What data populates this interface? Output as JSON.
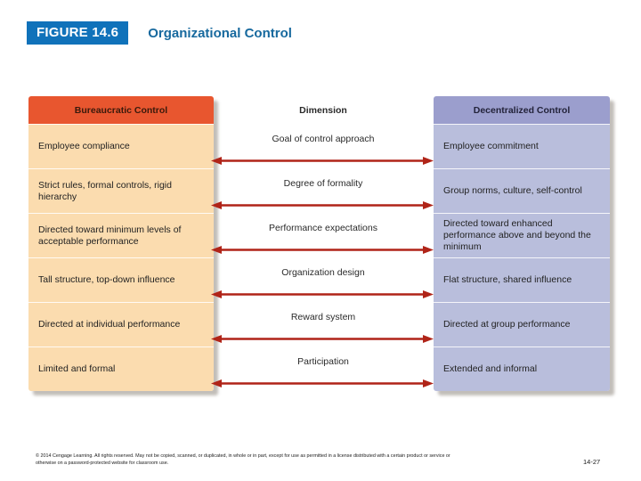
{
  "header": {
    "figure_badge": "FIGURE 14.6",
    "figure_title": "Organizational Control",
    "badge_color": "#1072BA",
    "title_color": "#17699E"
  },
  "diagram": {
    "left_column": {
      "header": "Bureaucratic Control",
      "header_color": "#E8562F",
      "cell_color": "#FBDCAF",
      "cells": [
        "Employee compliance",
        "Strict rules, formal controls, rigid hierarchy",
        "Directed toward minimum levels of acceptable performance",
        "Tall structure, top-down influence",
        "Directed at individual performance",
        "Limited and formal"
      ]
    },
    "middle_column": {
      "header": "Dimension",
      "arrow_color": "#B02418",
      "labels": [
        "Goal of control approach",
        "Degree of formality",
        "Performance expectations",
        "Organization design",
        "Reward system",
        "Participation"
      ]
    },
    "right_column": {
      "header": "Decentralized Control",
      "header_color": "#9B9ECD",
      "cell_color": "#B9BEDC",
      "cells": [
        "Employee commitment",
        "Group norms, culture, self-control",
        "Directed toward enhanced performance above and beyond the minimum",
        "Flat structure, shared influence",
        "Directed at group performance",
        "Extended and informal"
      ]
    }
  },
  "footer": {
    "copyright": "© 2014 Cengage Learning. All rights reserved. May not be copied, scanned, or duplicated, in whole or in part, except for use as permitted in a license distributed with a certain product or service or otherwise on a password-protected website for classroom use.",
    "page_number": "14-27"
  }
}
